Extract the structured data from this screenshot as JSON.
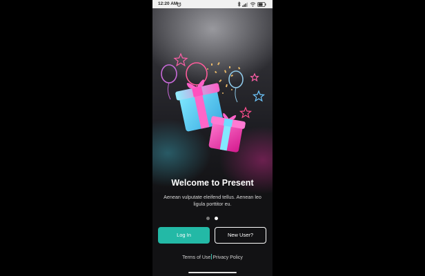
{
  "status_bar": {
    "time": "12:20 AM",
    "alarm_icon": "alarm-clock-icon",
    "icons": [
      "bluetooth-icon",
      "signal-icon",
      "wifi-icon",
      "battery-icon"
    ],
    "battery": "66"
  },
  "onboarding": {
    "title": "Welcome to Present",
    "subtitle": "Aenean vulputate eleifend tellus. Aenean leo ligula porttitor eu.",
    "page_count": 2,
    "active_page": 2,
    "illustration": "neon-gift-boxes-illustration"
  },
  "actions": {
    "login_label": "Log In",
    "new_user_label": "New User?"
  },
  "footer": {
    "terms_label": "Terms of Use",
    "privacy_label": "Privacy Policy"
  },
  "colors": {
    "accent": "#23b9a6",
    "background": "#141416",
    "neon_pink": "#ff3fb0",
    "neon_cyan": "#5fe3ff"
  }
}
